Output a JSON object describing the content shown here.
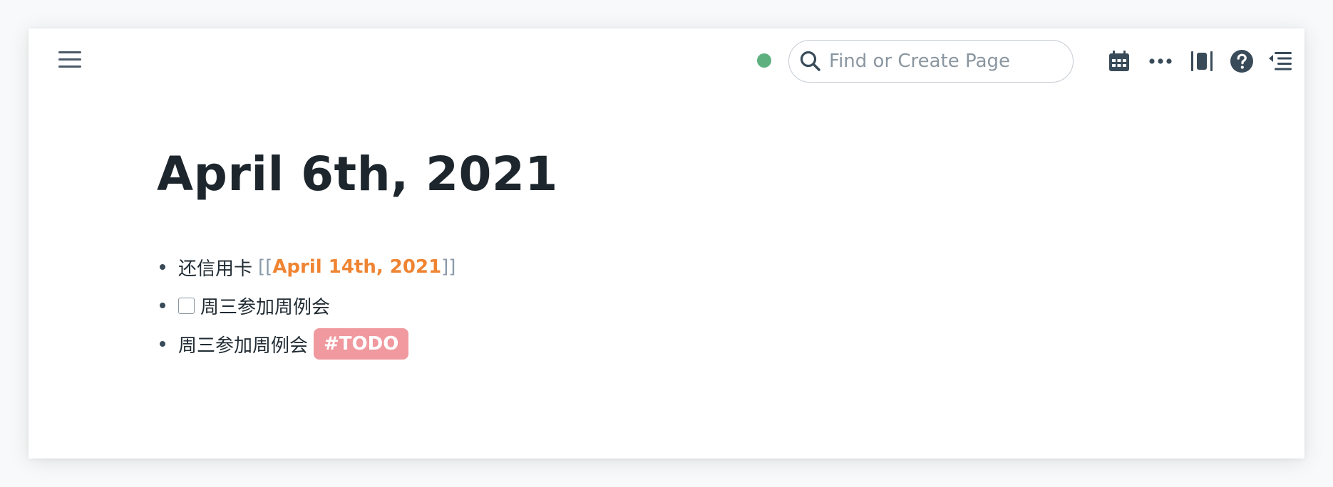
{
  "topbar": {
    "search_placeholder": "Find or Create Page",
    "sync_status_color": "#5fb07f",
    "icons": [
      "menu-icon",
      "search-icon",
      "calendar-icon",
      "more-icon",
      "sidebar-toggle-icon",
      "help-icon",
      "right-sidebar-icon"
    ]
  },
  "page": {
    "title": "April 6th, 2021",
    "blocks": [
      {
        "text": "还信用卡",
        "open_bracket": "[[",
        "ref": "April 14th, 2021",
        "close_bracket": "]]"
      },
      {
        "checkbox": false,
        "text": "周三参加周例会"
      },
      {
        "text": "周三参加周例会",
        "tag": "#TODO"
      }
    ]
  },
  "colors": {
    "page_ref": "#ef8432",
    "tag_bg": "#f0999e",
    "bracket": "#8a9aab"
  }
}
